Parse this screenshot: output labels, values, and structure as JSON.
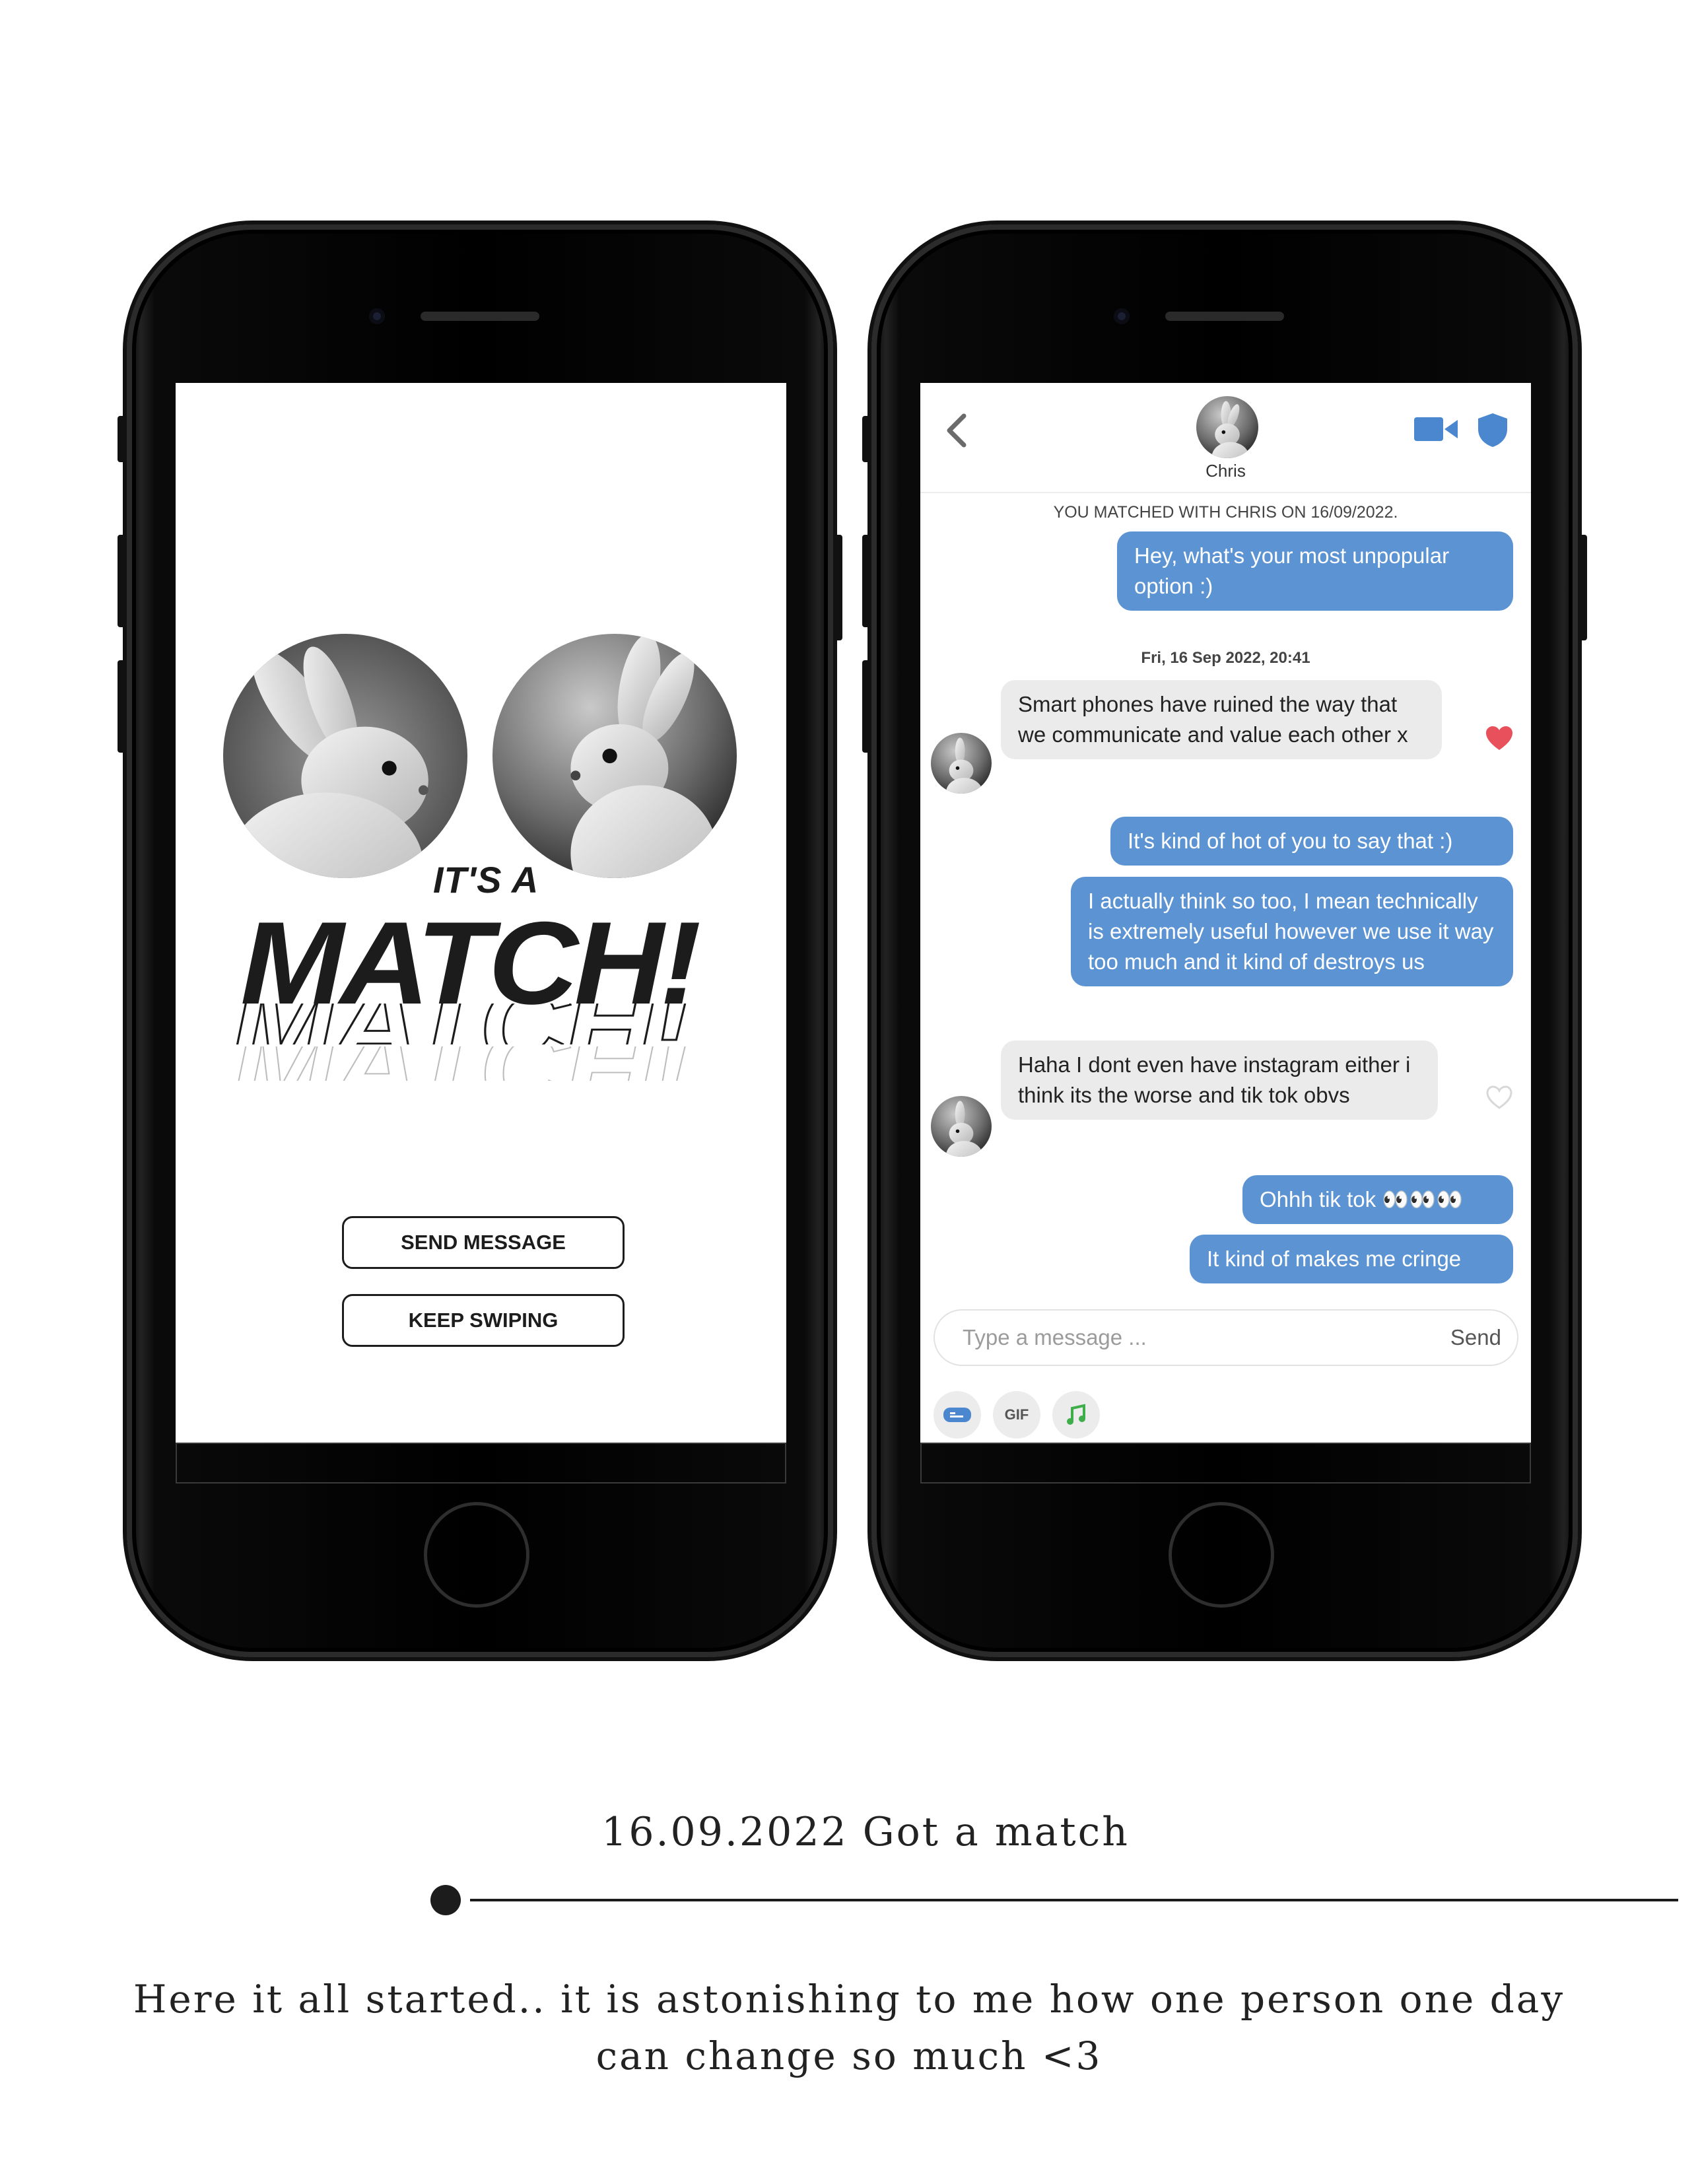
{
  "left_phone": {
    "headline_small": "IT'S A",
    "headline_big": "MATCH!",
    "send_message_label": "SEND MESSAGE",
    "keep_swiping_label": "KEEP SWIPING"
  },
  "right_phone": {
    "contact_name": "Chris",
    "matched_notice": "YOU MATCHED WITH CHRIS ON 16/09/2022.",
    "timestamp": "Fri, 16 Sep 2022, 20:41",
    "messages": [
      {
        "dir": "out",
        "text": "Hey, what's your most unpopular option :)"
      },
      {
        "dir": "in",
        "text": "Smart phones have ruined the way that we communicate and value each other x",
        "liked": true
      },
      {
        "dir": "out",
        "text": "It's kind of hot of you to say that :)"
      },
      {
        "dir": "out",
        "text": "I actually think so too, I mean technically is extremely useful however we use it way too much and it kind of destroys us"
      },
      {
        "dir": "in",
        "text": "Haha I dont even have instagram either i think its the worse and tik tok obvs",
        "liked": false
      },
      {
        "dir": "out",
        "text": "Ohhh tik tok 👀👀👀"
      },
      {
        "dir": "out",
        "text": "It kind of makes me cringe"
      }
    ],
    "input_placeholder": "Type a message ...",
    "send_label": "Send",
    "gif_label": "GIF",
    "icons": [
      "back-chevron-icon",
      "video-call-icon",
      "safety-shield-icon",
      "heart-icon",
      "sticker-icon",
      "music-note-icon"
    ],
    "accent_color": "#5b93d3",
    "heart_color": "#e8505b"
  },
  "caption": {
    "title": "16.09.2022   Got a match",
    "body": "Here it all started.. it is astonishing to me how one person one day can change so much <3"
  }
}
